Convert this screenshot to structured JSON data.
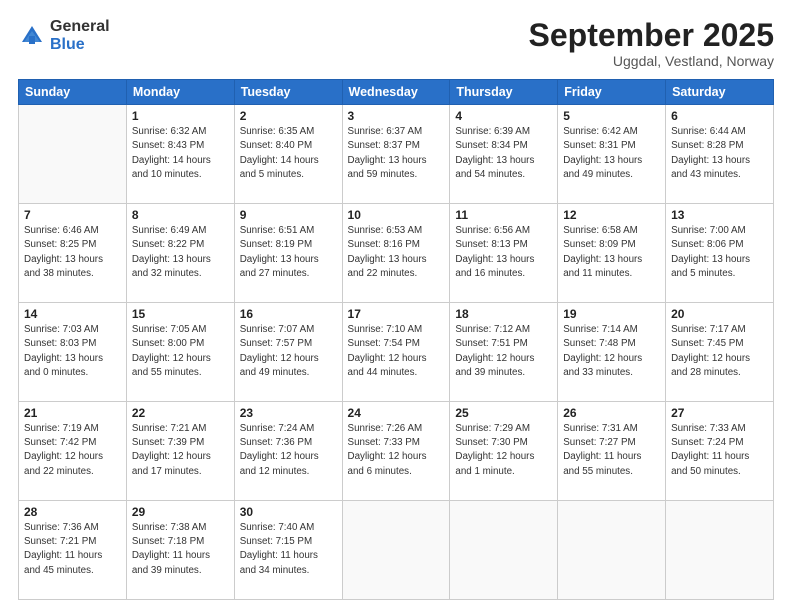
{
  "header": {
    "logo_general": "General",
    "logo_blue": "Blue",
    "month_title": "September 2025",
    "subtitle": "Uggdal, Vestland, Norway"
  },
  "weekdays": [
    "Sunday",
    "Monday",
    "Tuesday",
    "Wednesday",
    "Thursday",
    "Friday",
    "Saturday"
  ],
  "weeks": [
    [
      {
        "day": "",
        "info": ""
      },
      {
        "day": "1",
        "info": "Sunrise: 6:32 AM\nSunset: 8:43 PM\nDaylight: 14 hours\nand 10 minutes."
      },
      {
        "day": "2",
        "info": "Sunrise: 6:35 AM\nSunset: 8:40 PM\nDaylight: 14 hours\nand 5 minutes."
      },
      {
        "day": "3",
        "info": "Sunrise: 6:37 AM\nSunset: 8:37 PM\nDaylight: 13 hours\nand 59 minutes."
      },
      {
        "day": "4",
        "info": "Sunrise: 6:39 AM\nSunset: 8:34 PM\nDaylight: 13 hours\nand 54 minutes."
      },
      {
        "day": "5",
        "info": "Sunrise: 6:42 AM\nSunset: 8:31 PM\nDaylight: 13 hours\nand 49 minutes."
      },
      {
        "day": "6",
        "info": "Sunrise: 6:44 AM\nSunset: 8:28 PM\nDaylight: 13 hours\nand 43 minutes."
      }
    ],
    [
      {
        "day": "7",
        "info": "Sunrise: 6:46 AM\nSunset: 8:25 PM\nDaylight: 13 hours\nand 38 minutes."
      },
      {
        "day": "8",
        "info": "Sunrise: 6:49 AM\nSunset: 8:22 PM\nDaylight: 13 hours\nand 32 minutes."
      },
      {
        "day": "9",
        "info": "Sunrise: 6:51 AM\nSunset: 8:19 PM\nDaylight: 13 hours\nand 27 minutes."
      },
      {
        "day": "10",
        "info": "Sunrise: 6:53 AM\nSunset: 8:16 PM\nDaylight: 13 hours\nand 22 minutes."
      },
      {
        "day": "11",
        "info": "Sunrise: 6:56 AM\nSunset: 8:13 PM\nDaylight: 13 hours\nand 16 minutes."
      },
      {
        "day": "12",
        "info": "Sunrise: 6:58 AM\nSunset: 8:09 PM\nDaylight: 13 hours\nand 11 minutes."
      },
      {
        "day": "13",
        "info": "Sunrise: 7:00 AM\nSunset: 8:06 PM\nDaylight: 13 hours\nand 5 minutes."
      }
    ],
    [
      {
        "day": "14",
        "info": "Sunrise: 7:03 AM\nSunset: 8:03 PM\nDaylight: 13 hours\nand 0 minutes."
      },
      {
        "day": "15",
        "info": "Sunrise: 7:05 AM\nSunset: 8:00 PM\nDaylight: 12 hours\nand 55 minutes."
      },
      {
        "day": "16",
        "info": "Sunrise: 7:07 AM\nSunset: 7:57 PM\nDaylight: 12 hours\nand 49 minutes."
      },
      {
        "day": "17",
        "info": "Sunrise: 7:10 AM\nSunset: 7:54 PM\nDaylight: 12 hours\nand 44 minutes."
      },
      {
        "day": "18",
        "info": "Sunrise: 7:12 AM\nSunset: 7:51 PM\nDaylight: 12 hours\nand 39 minutes."
      },
      {
        "day": "19",
        "info": "Sunrise: 7:14 AM\nSunset: 7:48 PM\nDaylight: 12 hours\nand 33 minutes."
      },
      {
        "day": "20",
        "info": "Sunrise: 7:17 AM\nSunset: 7:45 PM\nDaylight: 12 hours\nand 28 minutes."
      }
    ],
    [
      {
        "day": "21",
        "info": "Sunrise: 7:19 AM\nSunset: 7:42 PM\nDaylight: 12 hours\nand 22 minutes."
      },
      {
        "day": "22",
        "info": "Sunrise: 7:21 AM\nSunset: 7:39 PM\nDaylight: 12 hours\nand 17 minutes."
      },
      {
        "day": "23",
        "info": "Sunrise: 7:24 AM\nSunset: 7:36 PM\nDaylight: 12 hours\nand 12 minutes."
      },
      {
        "day": "24",
        "info": "Sunrise: 7:26 AM\nSunset: 7:33 PM\nDaylight: 12 hours\nand 6 minutes."
      },
      {
        "day": "25",
        "info": "Sunrise: 7:29 AM\nSunset: 7:30 PM\nDaylight: 12 hours\nand 1 minute."
      },
      {
        "day": "26",
        "info": "Sunrise: 7:31 AM\nSunset: 7:27 PM\nDaylight: 11 hours\nand 55 minutes."
      },
      {
        "day": "27",
        "info": "Sunrise: 7:33 AM\nSunset: 7:24 PM\nDaylight: 11 hours\nand 50 minutes."
      }
    ],
    [
      {
        "day": "28",
        "info": "Sunrise: 7:36 AM\nSunset: 7:21 PM\nDaylight: 11 hours\nand 45 minutes."
      },
      {
        "day": "29",
        "info": "Sunrise: 7:38 AM\nSunset: 7:18 PM\nDaylight: 11 hours\nand 39 minutes."
      },
      {
        "day": "30",
        "info": "Sunrise: 7:40 AM\nSunset: 7:15 PM\nDaylight: 11 hours\nand 34 minutes."
      },
      {
        "day": "",
        "info": ""
      },
      {
        "day": "",
        "info": ""
      },
      {
        "day": "",
        "info": ""
      },
      {
        "day": "",
        "info": ""
      }
    ]
  ]
}
